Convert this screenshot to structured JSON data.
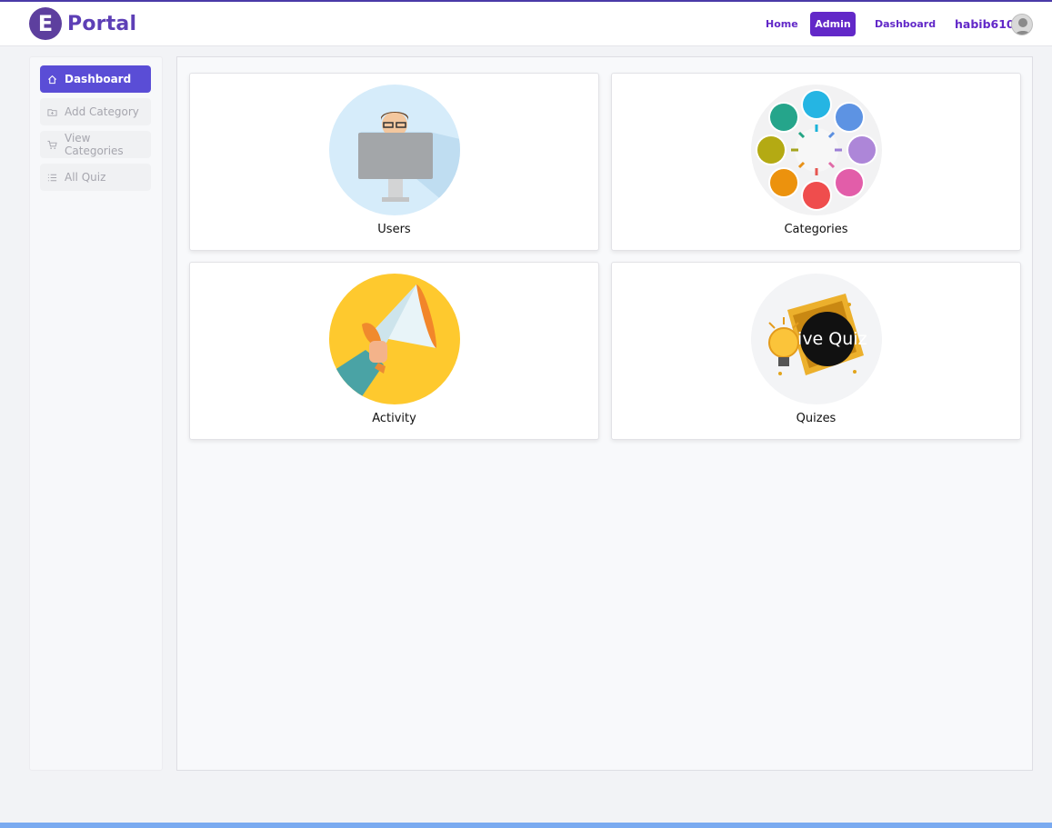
{
  "brand": {
    "letter": "E",
    "name": "Portal"
  },
  "nav": {
    "home": "Home",
    "admin": "Admin",
    "dashboard": "Dashboard",
    "username": "habib610"
  },
  "sidebar": {
    "items": [
      {
        "label": "Dashboard",
        "icon": "home-icon",
        "active": true
      },
      {
        "label": "Add Category",
        "icon": "folder-add-icon",
        "active": false
      },
      {
        "label": "View Categories",
        "icon": "cart-icon",
        "active": false
      },
      {
        "label": "All Quiz",
        "icon": "list-icon",
        "active": false
      }
    ]
  },
  "cards": [
    {
      "title": "Users",
      "image": "user-at-computer-illustration"
    },
    {
      "title": "Categories",
      "image": "colored-circles-cycle-illustration"
    },
    {
      "title": "Activity",
      "image": "megaphone-illustration"
    },
    {
      "title": "Quizes",
      "image": "live-quiz-illustration",
      "image_text": "Live Quiz"
    }
  ],
  "colors": {
    "accent": "#6228c8",
    "sidebar_active": "#5a4dd6",
    "footer": "#7aaaf0"
  }
}
